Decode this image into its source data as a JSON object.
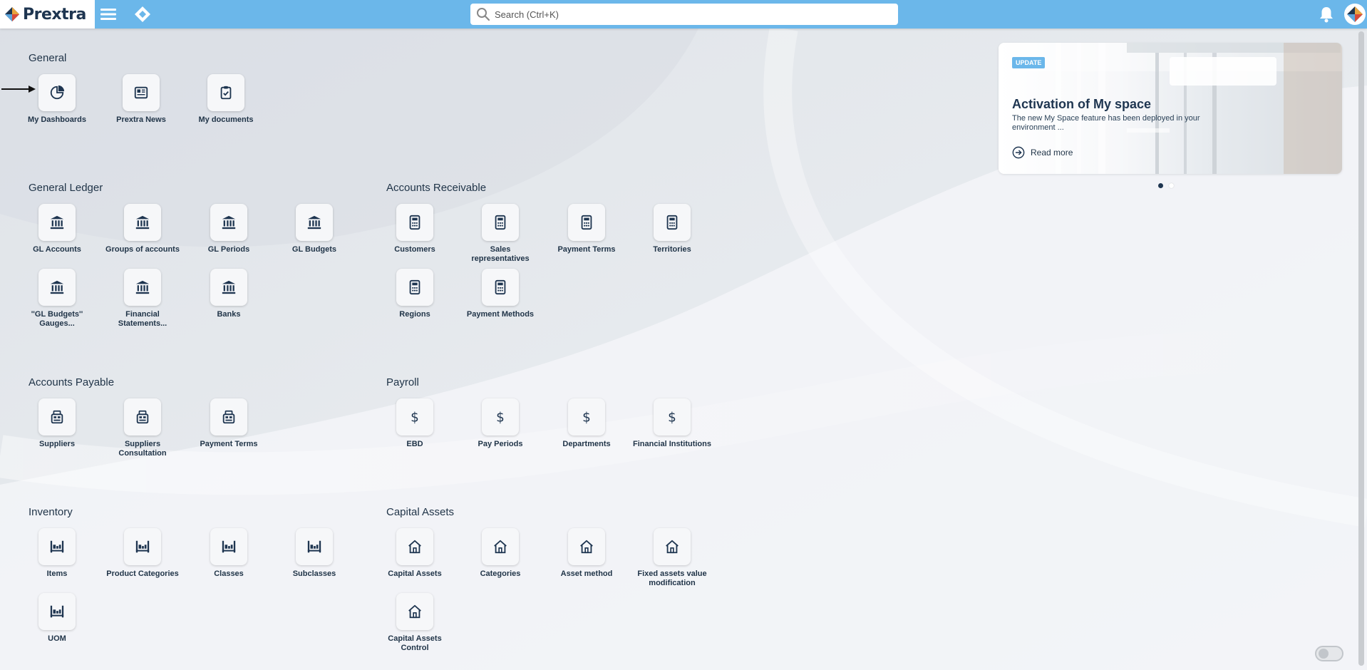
{
  "header": {
    "logo_text": "Prextra",
    "search_placeholder": "Search (Ctrl+K)",
    "icons": [
      "hamburger-menu-icon",
      "diamond-home-icon",
      "search-icon",
      "bell-icon",
      "avatar-logo-icon"
    ],
    "bar_color": "#6bb7ea"
  },
  "sections": [
    {
      "id": "general",
      "title": "General",
      "tiles": [
        {
          "label": "My Dashboards",
          "icon": "pie-chart-icon"
        },
        {
          "label": "Prextra News",
          "icon": "newspaper-icon"
        },
        {
          "label": "My documents",
          "icon": "clipboard-check-icon"
        }
      ]
    },
    {
      "id": "general-ledger",
      "title": "General Ledger",
      "tiles": [
        {
          "label": "GL Accounts",
          "icon": "bank-icon"
        },
        {
          "label": "Groups of accounts",
          "icon": "bank-icon"
        },
        {
          "label": "GL Periods",
          "icon": "bank-icon"
        },
        {
          "label": "GL Budgets",
          "icon": "bank-icon"
        },
        {
          "label": "''GL Budgets'' Gauges...",
          "icon": "bank-icon"
        },
        {
          "label": "Financial Statements...",
          "icon": "bank-icon"
        },
        {
          "label": "Banks",
          "icon": "bank-icon"
        }
      ]
    },
    {
      "id": "accounts-receivable",
      "title": "Accounts Receivable",
      "tiles": [
        {
          "label": "Customers",
          "icon": "calculator-icon"
        },
        {
          "label": "Sales representatives",
          "icon": "calculator-icon"
        },
        {
          "label": "Payment Terms",
          "icon": "calculator-icon"
        },
        {
          "label": "Territories",
          "icon": "calculator-icon"
        },
        {
          "label": "Regions",
          "icon": "calculator-icon"
        },
        {
          "label": "Payment Methods",
          "icon": "calculator-icon"
        }
      ]
    },
    {
      "id": "accounts-payable",
      "title": "Accounts Payable",
      "tiles": [
        {
          "label": "Suppliers",
          "icon": "cash-register-icon"
        },
        {
          "label": "Suppliers Consultation",
          "icon": "cash-register-icon"
        },
        {
          "label": "Payment Terms",
          "icon": "cash-register-icon"
        }
      ]
    },
    {
      "id": "payroll",
      "title": "Payroll",
      "tiles": [
        {
          "label": "EBD",
          "icon": "dollar-icon"
        },
        {
          "label": "Pay Periods",
          "icon": "dollar-icon"
        },
        {
          "label": "Departments",
          "icon": "dollar-icon"
        },
        {
          "label": "Financial Institutions",
          "icon": "dollar-icon"
        }
      ]
    },
    {
      "id": "inventory",
      "title": "Inventory",
      "tiles": [
        {
          "label": "Items",
          "icon": "shelves-icon"
        },
        {
          "label": "Product Categories",
          "icon": "shelves-icon"
        },
        {
          "label": "Classes",
          "icon": "shelves-icon"
        },
        {
          "label": "Subclasses",
          "icon": "shelves-icon"
        },
        {
          "label": "UOM",
          "icon": "shelves-icon"
        }
      ]
    },
    {
      "id": "capital-assets",
      "title": "Capital Assets",
      "tiles": [
        {
          "label": "Capital Assets",
          "icon": "house-icon"
        },
        {
          "label": "Categories",
          "icon": "house-icon"
        },
        {
          "label": "Asset method",
          "icon": "house-icon"
        },
        {
          "label": "Fixed assets value modification",
          "icon": "house-icon"
        },
        {
          "label": "Capital Assets Control",
          "icon": "house-icon"
        }
      ]
    }
  ],
  "news": {
    "badge": "UPDATE",
    "title": "Activation of My space",
    "description": "The new My Space feature has been deployed in your environment ...",
    "read_more": "Read more",
    "active_slide": 1,
    "slide_count": 2
  },
  "colors": {
    "text_dark": "#1f3347",
    "accent": "#6bb7ea",
    "tile_bg": "#f6f7f9",
    "dot_active": "#1e3550",
    "dot_inactive": "#ffffff"
  }
}
